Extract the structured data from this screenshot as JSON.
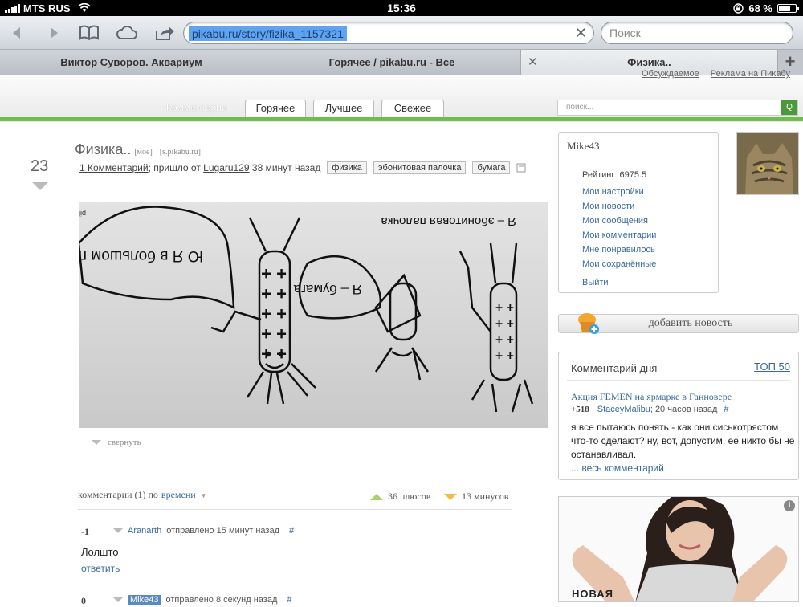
{
  "status": {
    "carrier": "MTS RUS",
    "time": "15:36",
    "battery": "68 %",
    "battery_level": 0.68
  },
  "browser": {
    "url": "pikabu.ru/story/fizika_1157321",
    "search_placeholder": "Поиск",
    "tabs": [
      {
        "label": "Виктор Суворов. Аквариум",
        "active": false
      },
      {
        "label": "Горячее / pikabu.ru - Все",
        "active": false
      },
      {
        "label": "Физика..",
        "active": true
      }
    ]
  },
  "site": {
    "top_links": [
      "Обсуждаемое",
      "Реклама на Пикабу"
    ],
    "nav_label": "Комментарии",
    "nav_tabs": [
      "Горячее",
      "Лучшее",
      "Свежее"
    ],
    "search_placeholder": "поиск...",
    "search_go": "Q",
    "accent_color": "#6cc04a"
  },
  "story": {
    "votes": "23",
    "title": "Физика..",
    "mine": "[моё]",
    "source": "[s.pikabu.ru]",
    "comments_link": "1 Комментарий",
    "from_text": "; пришло от",
    "author": "Lugaru129",
    "time": "38 минут назад",
    "tags": [
      "физика",
      "эбонитовая палочка",
      "бумага"
    ],
    "image_watermark": "pikabu.ru",
    "drawing_texts": {
      "stick": "Я – эбонитовая палочка",
      "paper": "Я – бумага",
      "plus": "Ю Я в большом плюсе!"
    },
    "collapse": "свернуть"
  },
  "comments": {
    "header_prefix": "комментарии (1) по",
    "sort": "времени",
    "pluses": "36 плюсов",
    "minuses": "13 минусов",
    "items": [
      {
        "score": "-1",
        "author": "Aranarth",
        "meta": "отправлено 15 минут назад",
        "hash": "#",
        "body": "Лолшто",
        "reply": "ответить"
      },
      {
        "score": "0",
        "author": "Mike43",
        "meta": "отправлено 8 секунд назад",
        "hash": "#"
      }
    ]
  },
  "sidebar": {
    "username": "Mike43",
    "rating": "Рейтинг: 6975.5",
    "links": [
      "Мои настройки",
      "Мои новости",
      "Мои сообщения",
      "Мои комментарии",
      "Мне понравилось",
      "Мои сохранённые"
    ],
    "logout": "Выйти",
    "add_news": "добавить новость",
    "cotd": {
      "title": "Комментарий дня",
      "top": "ТОП 50",
      "link": "Акция FEMEN на ярмарке в Ганновере",
      "score": "+518",
      "author": "StaceyMalibu",
      "time": "; 20 часов назад",
      "hash": "#",
      "text": "я все пытаюсь понять - как они сиськотрястом что-то сделают? ну, вот, допустим, ее никто бы не останавливал.",
      "more_prefix": "... ",
      "more": "весь комментарий"
    },
    "ad": {
      "label": "НОВАЯ",
      "info": "i"
    }
  }
}
